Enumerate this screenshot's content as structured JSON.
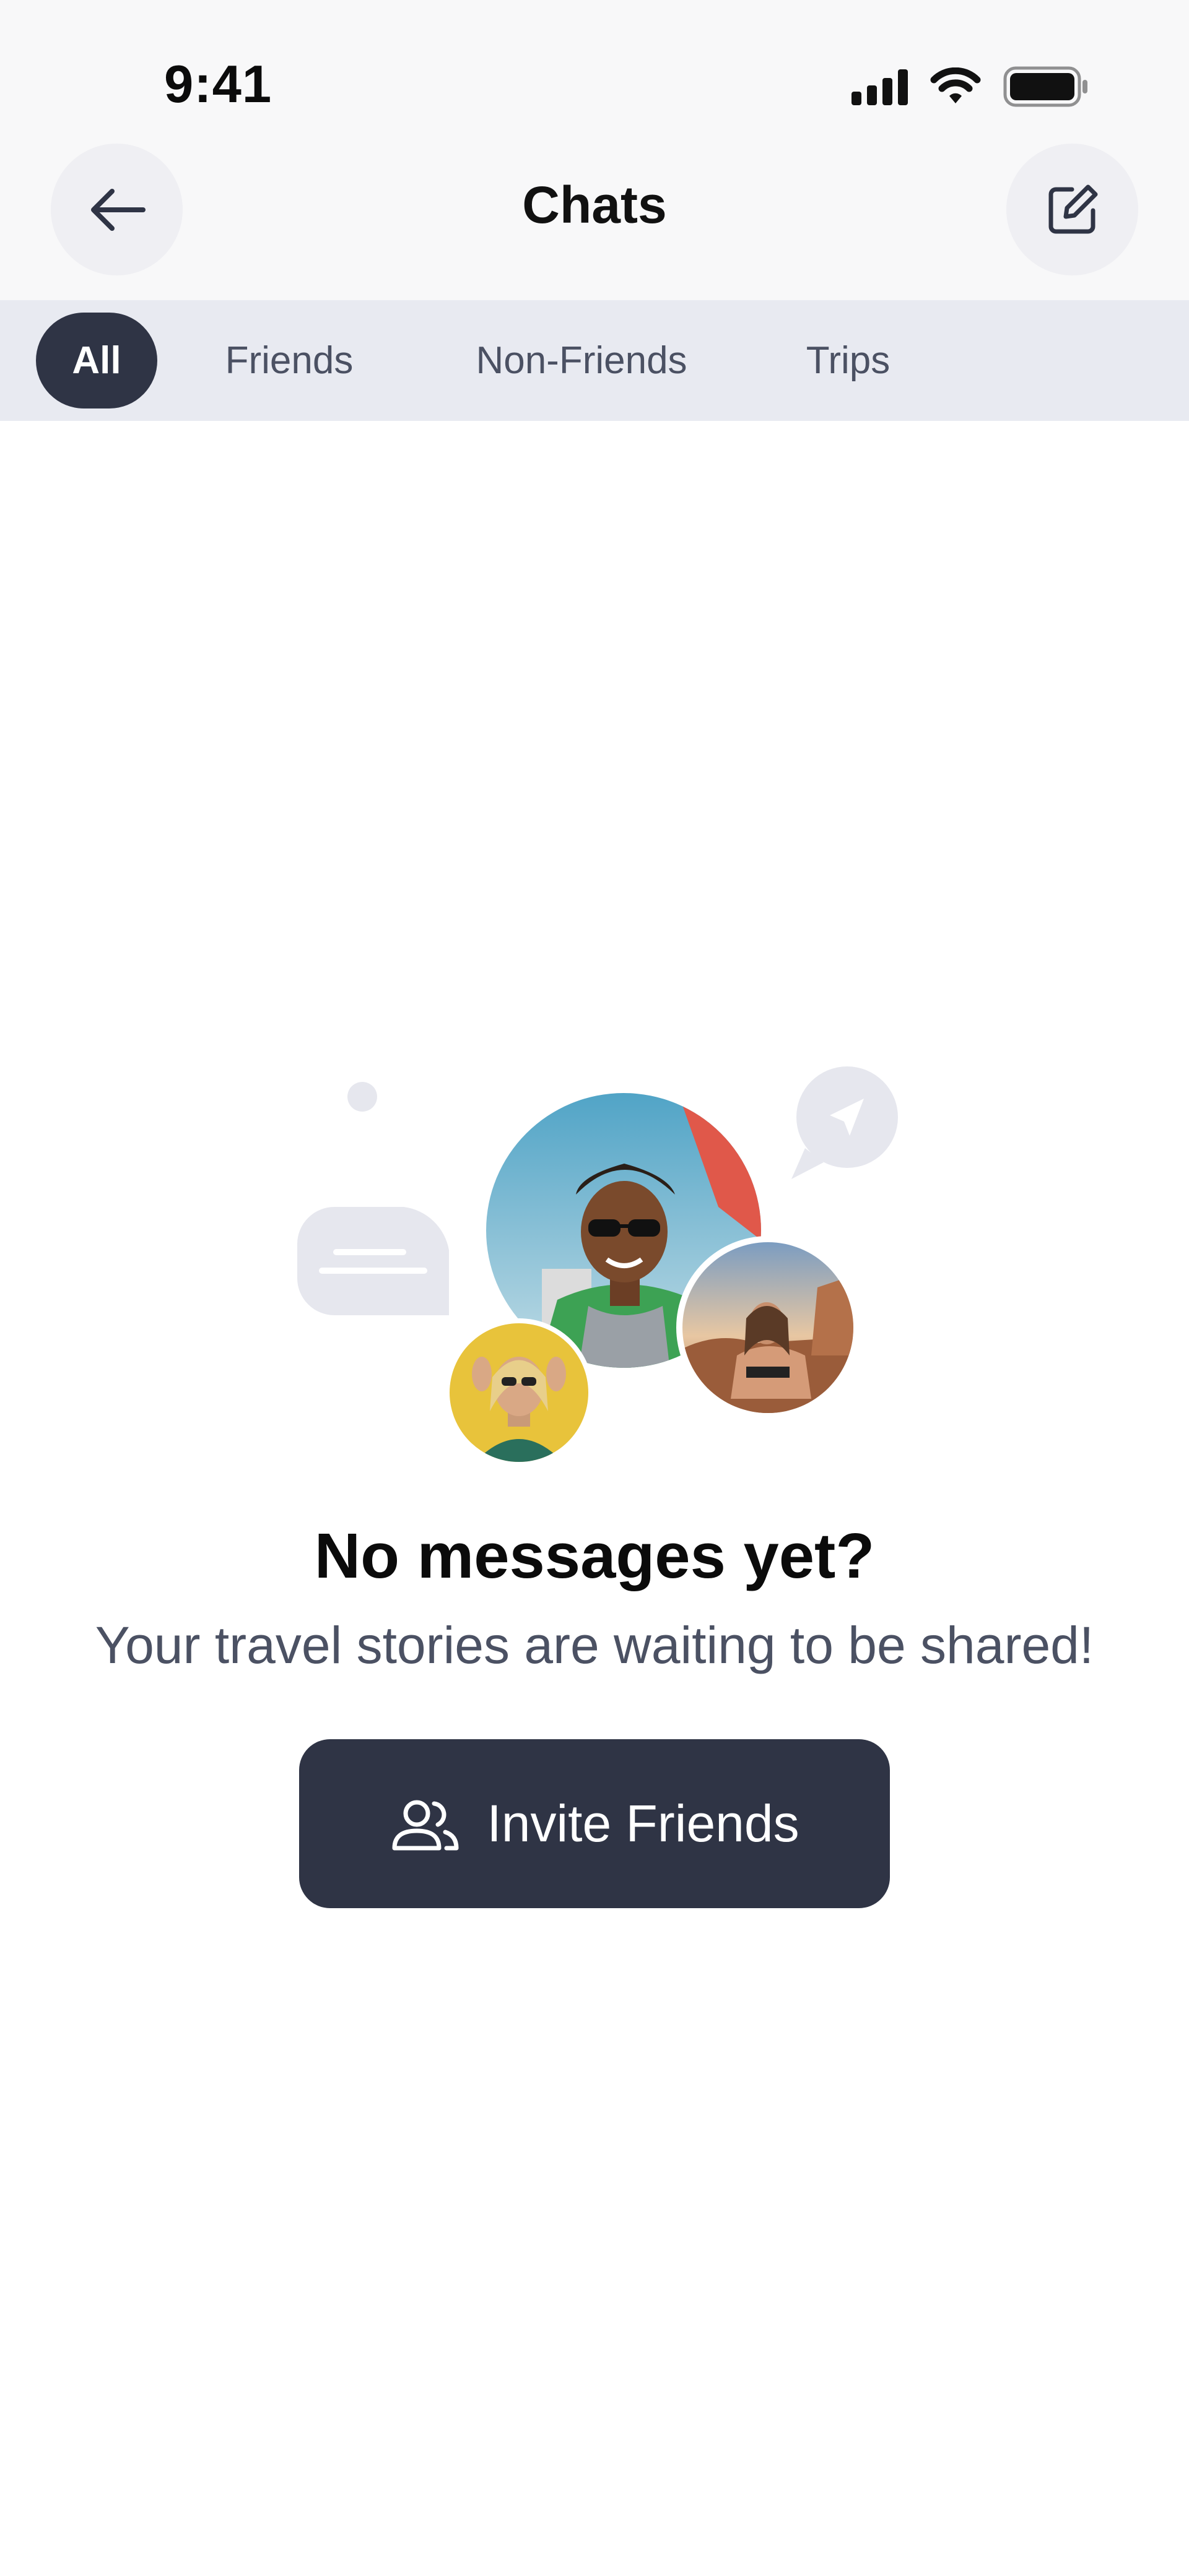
{
  "status_bar": {
    "time": "9:41",
    "icons": [
      "cellular-signal-icon",
      "wifi-icon",
      "battery-icon"
    ]
  },
  "header": {
    "title": "Chats",
    "back_icon": "arrow-left-icon",
    "compose_icon": "compose-icon"
  },
  "tabs": [
    {
      "label": "All",
      "active": true
    },
    {
      "label": "Friends",
      "active": false
    },
    {
      "label": "Non-Friends",
      "active": false
    },
    {
      "label": "Trips",
      "active": false
    }
  ],
  "empty_state": {
    "title": "No messages yet?",
    "subtitle": "Your travel stories are waiting to be shared!",
    "button_label": "Invite Friends",
    "button_icon": "users-icon",
    "illustration_icons": [
      "chat-bubble-icon",
      "send-icon",
      "avatar-man",
      "avatar-woman-yellow",
      "avatar-woman-beach"
    ]
  },
  "colors": {
    "primary_dark": "#2f3445",
    "tab_bar_bg": "#e8eaf1",
    "header_bg": "#f8f8f9",
    "muted_text": "#4b5163",
    "icon_bg": "#efeff3"
  }
}
